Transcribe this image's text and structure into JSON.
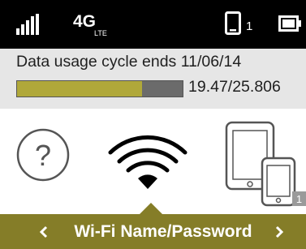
{
  "status_bar": {
    "network": "4G",
    "network_sub": "LTE",
    "connected_devices": "1"
  },
  "usage": {
    "cycle_text": "Data usage cycle ends 11/06/14",
    "amount_text": "19.47/25.806",
    "used_fraction": 0.754
  },
  "icons": {
    "help": "help-icon",
    "wifi": "wifi-icon",
    "devices": "connected-devices-icon",
    "devices_badge": "1"
  },
  "nav": {
    "label": "Wi-Fi Name/Password",
    "prev": "chevron-left-icon",
    "next": "chevron-right-icon"
  },
  "colors": {
    "accent": "#857d28",
    "usage_fill": "#b0a83a",
    "usage_track": "#6b6b6b",
    "status_bg": "#000000"
  }
}
